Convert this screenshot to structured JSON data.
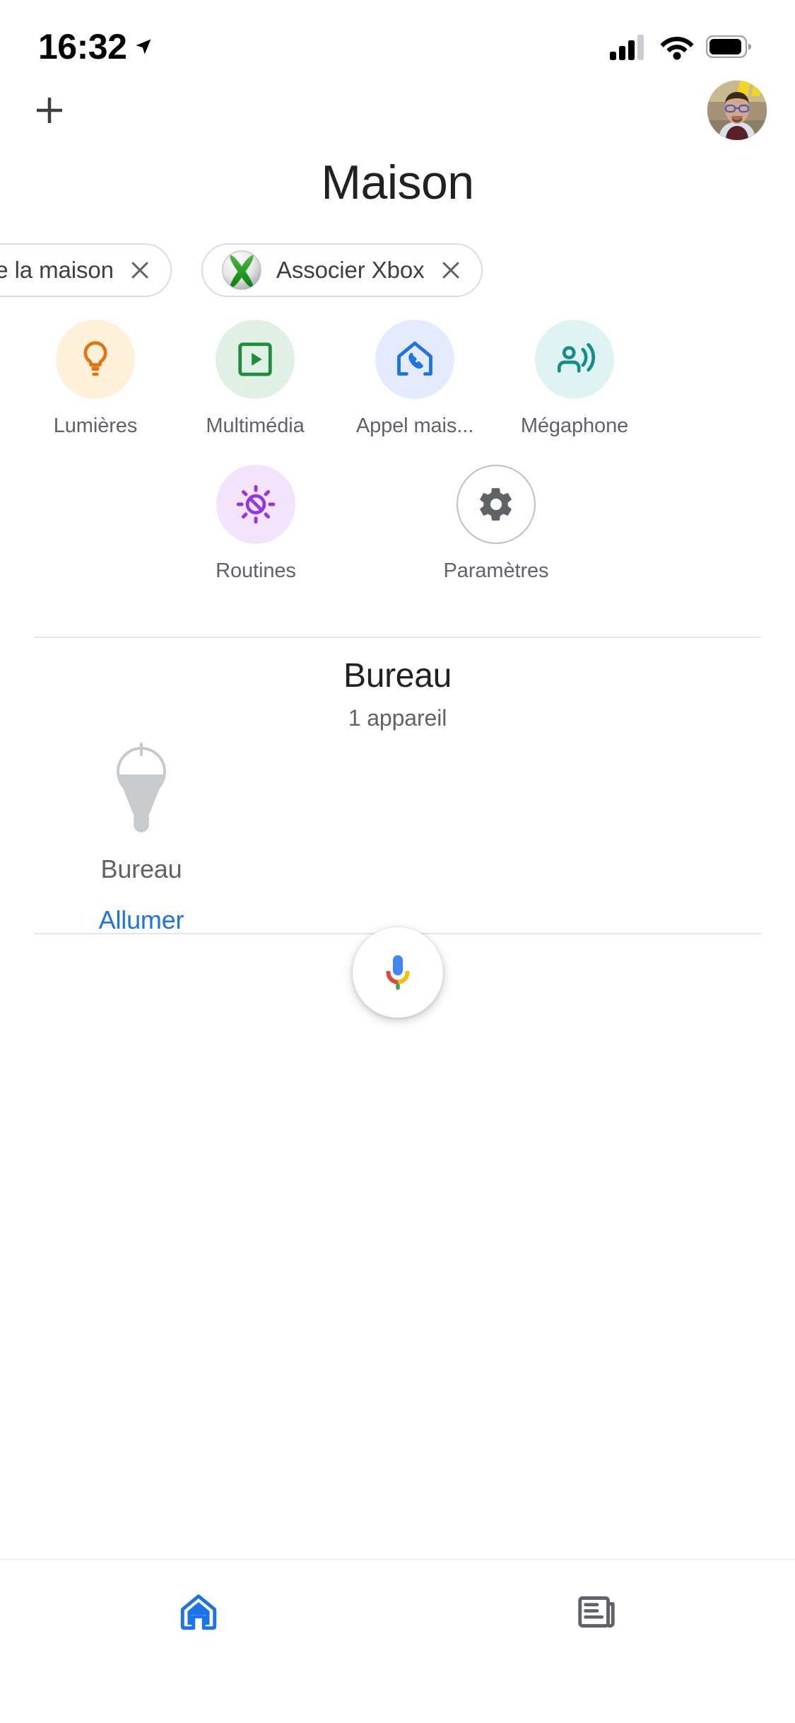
{
  "status_bar": {
    "time": "16:32",
    "location_icon": "location-arrow-icon",
    "cellular_icon": "cellular-signal-icon",
    "wifi_icon": "wifi-icon",
    "battery_icon": "battery-icon"
  },
  "header": {
    "add_icon": "plus-icon",
    "avatar_icon": "user-avatar"
  },
  "title": "Maison",
  "chips": [
    {
      "label": "rejoindre la maison",
      "icon": null,
      "close_icon": "close-icon"
    },
    {
      "label": "Associer Xbox",
      "icon": "xbox-logo-icon",
      "close_icon": "close-icon"
    }
  ],
  "quick_actions_row1": [
    {
      "label": "Lumières",
      "icon": "lightbulb-icon",
      "bg": "#fdf1da",
      "fg": "#e8710a"
    },
    {
      "label": "Multimédia",
      "icon": "media-play-icon",
      "bg": "#e0f0e4",
      "fg": "#1e8e3e"
    },
    {
      "label": "Appel mais...",
      "icon": "home-call-icon",
      "bg": "#e3ebfd",
      "fg": "#1a73e8"
    },
    {
      "label": "Mégaphone",
      "icon": "broadcast-icon",
      "bg": "#dff3f2",
      "fg": "#128c8c"
    }
  ],
  "quick_actions_row2": [
    {
      "label": "Routines",
      "icon": "routines-sun-icon",
      "bg": "#f4e4fb",
      "fg": "#9334e6"
    },
    {
      "label": "Paramètres",
      "icon": "gear-icon",
      "bg": "#ffffff",
      "fg": "#5f6368"
    }
  ],
  "room": {
    "name": "Bureau",
    "device_count": "1 appareil",
    "device": {
      "name": "Bureau",
      "icon": "pendant-lamp-icon",
      "action_label": "Allumer",
      "action_color": "#1a73e8"
    }
  },
  "assistant": {
    "fab_icon": "google-assistant-mic-icon"
  },
  "bottom_nav": [
    {
      "icon": "home-icon",
      "active": true,
      "color": "#1a73e8"
    },
    {
      "icon": "feed-icon",
      "active": false,
      "color": "#5f6368"
    }
  ]
}
